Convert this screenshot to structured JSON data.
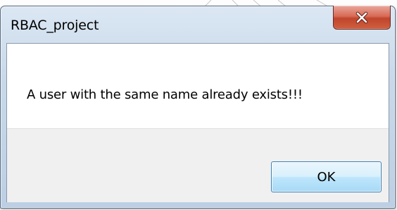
{
  "dialog": {
    "title": "RBAC_project",
    "message": "A user with the same name already exists!!!",
    "ok_label": "OK"
  },
  "icons": {
    "close": "close-icon"
  },
  "colors": {
    "close_button": "#c7503a",
    "ok_button_border": "#3c7fb1",
    "frame": "#c9d9ea",
    "button_pane": "#f0f0f0"
  }
}
